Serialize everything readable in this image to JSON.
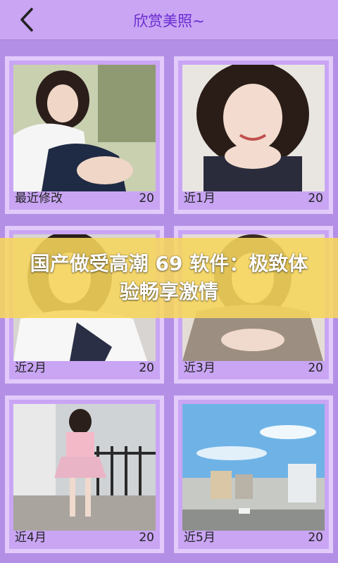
{
  "header": {
    "title": "欣赏美照~",
    "back_icon": "chevron-left-icon"
  },
  "albums": [
    {
      "label": "最近修改",
      "count": "20"
    },
    {
      "label": "近1月",
      "count": "20"
    },
    {
      "label": "近2月",
      "count": "20"
    },
    {
      "label": "近3月",
      "count": "20"
    },
    {
      "label": "近4月",
      "count": "20"
    },
    {
      "label": "近5月",
      "count": "20"
    }
  ],
  "banner": {
    "text": "国产做受高潮 69 软件：极致体验畅享激情"
  },
  "colors": {
    "background": "#b48fe6",
    "header": "#c9a5f4",
    "title": "#6a2bd0",
    "card_border": "#e2cbfb",
    "banner": "#f6d65c"
  }
}
